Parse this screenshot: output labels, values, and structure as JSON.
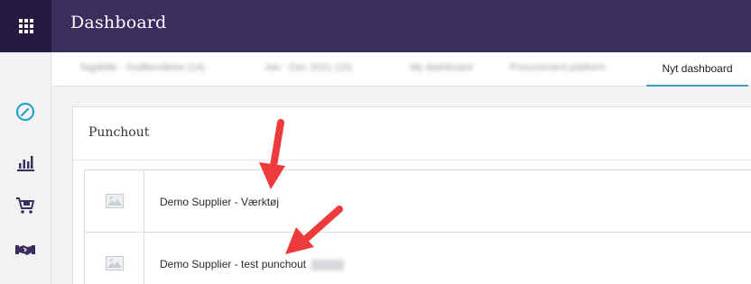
{
  "header": {
    "title": "Dashboard",
    "apps_icon": "apps-grid-icon",
    "background": "#3b2e5e"
  },
  "sidebar": {
    "items": [
      {
        "icon": "dashboard-dial-icon",
        "active": true
      },
      {
        "icon": "bar-chart-icon",
        "active": false
      },
      {
        "icon": "shopping-cart-icon",
        "active": false
      },
      {
        "icon": "handshake-icon",
        "active": false
      }
    ],
    "active_color": "#2aa1c7"
  },
  "tabs": {
    "items": [
      {
        "label": "Tagdelte · Godkendelse (14)",
        "blurred": true
      },
      {
        "label": "Jan · Dec 2021 (15)",
        "blurred": true
      },
      {
        "label": "My dashboard",
        "blurred": true
      },
      {
        "label": "Procurement platform",
        "blurred": true
      }
    ],
    "active_label": "Nyt dashboard",
    "accent": "#3aa1c4"
  },
  "card": {
    "title": "Punchout",
    "items": [
      {
        "label": "Demo Supplier - Værktøj",
        "thumb_icon": "image-placeholder-icon",
        "redacted_suffix": false
      },
      {
        "label": "Demo Supplier - test punchout",
        "thumb_icon": "image-placeholder-icon",
        "redacted_suffix": true
      }
    ]
  },
  "annotations": {
    "arrow_icon": "red-arrow-icon",
    "arrow_color": "#ee3a3a"
  }
}
